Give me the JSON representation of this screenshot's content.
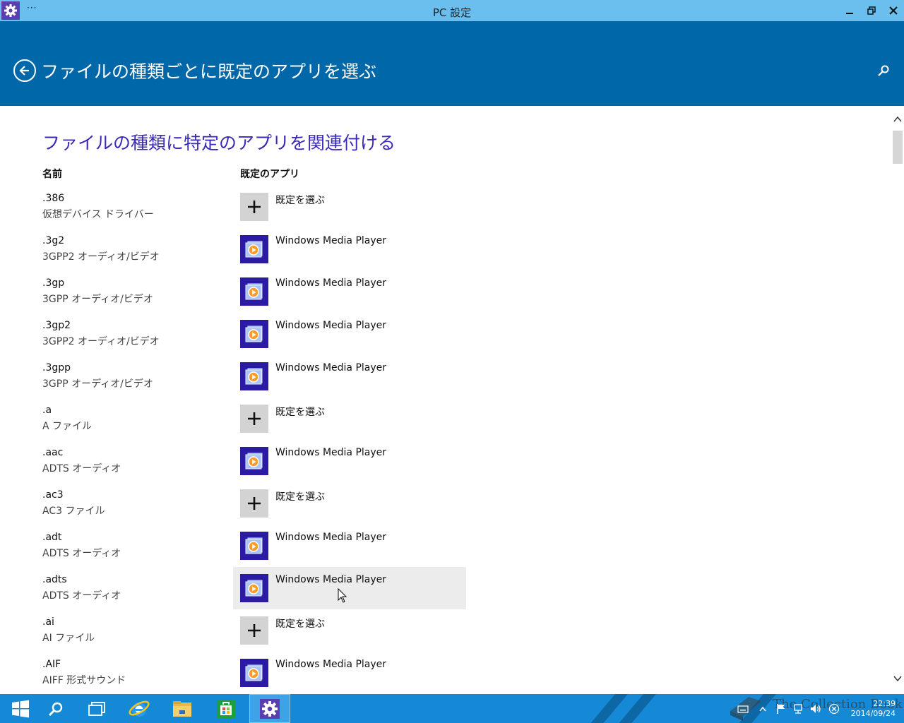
{
  "window": {
    "title": "PC 設定",
    "menu": "···"
  },
  "header": {
    "title": "ファイルの種類ごとに既定のアプリを選ぶ"
  },
  "section": {
    "title": "ファイルの種類に特定のアプリを関連付ける",
    "col_name": "名前",
    "col_app": "既定のアプリ"
  },
  "rows": [
    {
      "ext": ".386",
      "desc": "仮想デバイス ドライバー",
      "app": "既定を選ぶ",
      "icon": "plus-icon"
    },
    {
      "ext": ".3g2",
      "desc": "3GPP2 オーディオ/ビデオ",
      "app": "Windows Media Player",
      "icon": "windows-media-player-icon"
    },
    {
      "ext": ".3gp",
      "desc": "3GPP オーディオ/ビデオ",
      "app": "Windows Media Player",
      "icon": "windows-media-player-icon"
    },
    {
      "ext": ".3gp2",
      "desc": "3GPP2 オーディオ/ビデオ",
      "app": "Windows Media Player",
      "icon": "windows-media-player-icon"
    },
    {
      "ext": ".3gpp",
      "desc": "3GPP オーディオ/ビデオ",
      "app": "Windows Media Player",
      "icon": "windows-media-player-icon"
    },
    {
      "ext": ".a",
      "desc": "A ファイル",
      "app": "既定を選ぶ",
      "icon": "plus-icon"
    },
    {
      "ext": ".aac",
      "desc": "ADTS オーディオ",
      "app": "Windows Media Player",
      "icon": "windows-media-player-icon"
    },
    {
      "ext": ".ac3",
      "desc": "AC3 ファイル",
      "app": "既定を選ぶ",
      "icon": "plus-icon"
    },
    {
      "ext": ".adt",
      "desc": "ADTS オーディオ",
      "app": "Windows Media Player",
      "icon": "windows-media-player-icon"
    },
    {
      "ext": ".adts",
      "desc": "ADTS オーディオ",
      "app": "Windows Media Player",
      "icon": "windows-media-player-icon"
    },
    {
      "ext": ".ai",
      "desc": "AI ファイル",
      "app": "既定を選ぶ",
      "icon": "plus-icon"
    },
    {
      "ext": ".AIF",
      "desc": "AIFF 形式サウンド",
      "app": "Windows Media Player",
      "icon": "windows-media-player-icon"
    }
  ],
  "taskbar": {
    "time": "22:39",
    "date": "2014/09/24",
    "watermark": "The Collection Book"
  },
  "colors": {
    "titlebar": "#6bbfef",
    "header": "#0068a8",
    "section_title": "#3a2ab8",
    "taskbar": "#1689d6",
    "wmp_tile": "#2b1aa3"
  }
}
